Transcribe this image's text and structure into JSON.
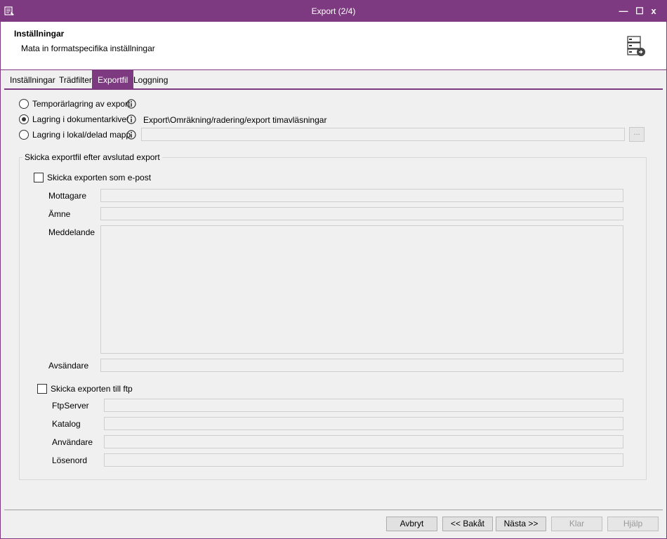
{
  "window": {
    "title": "Export (2/4)",
    "minimize_label": "—",
    "maximize_label": "☐",
    "close_label": "x",
    "accent": "#7d3a80"
  },
  "header": {
    "title": "Inställningar",
    "subtitle": "Mata in formatspecifika inställningar"
  },
  "tabs": [
    {
      "label": "Inställningar",
      "active": false
    },
    {
      "label": "Trädfilter",
      "active": false
    },
    {
      "label": "Exportfil",
      "active": true
    },
    {
      "label": "Loggning",
      "active": false
    }
  ],
  "storage": {
    "options": [
      {
        "label": "Temporärlagring av export",
        "checked": false
      },
      {
        "label": "Lagring i dokumentarkivet",
        "checked": true
      },
      {
        "label": "Lagring i lokal/delad mapp",
        "checked": false
      }
    ],
    "archive_path": "Export\\Omräkning/radering/export timavläsningar",
    "folder_path": "",
    "browse_label": "..."
  },
  "send_group": {
    "legend": "Skicka exportfil efter avslutad export",
    "email": {
      "checkbox_label": "Skicka exporten som e-post",
      "checked": false,
      "recipient_label": "Mottagare",
      "subject_label": "Ämne",
      "message_label": "Meddelande",
      "sender_label": "Avsändare",
      "recipient_value": "",
      "subject_value": "",
      "message_value": "",
      "sender_value": ""
    },
    "ftp": {
      "checkbox_label": "Skicka exporten till ftp",
      "checked": false,
      "server_label": "FtpServer",
      "directory_label": "Katalog",
      "user_label": "Användare",
      "password_label": "Lösenord",
      "server_value": "",
      "directory_value": "",
      "user_value": "",
      "password_value": ""
    }
  },
  "buttons": {
    "cancel": "Avbryt",
    "back": "<< Bakåt",
    "next": "Nästa >>",
    "finish": "Klar",
    "help": "Hjälp"
  }
}
